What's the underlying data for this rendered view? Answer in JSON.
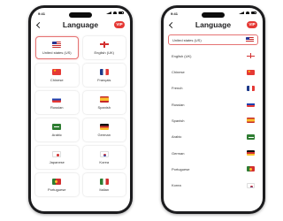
{
  "status_time": "9:41",
  "title": "Language",
  "badge": "VIP",
  "grid_items": [
    {
      "label": "United states (US)",
      "flag": "us",
      "selected": true
    },
    {
      "label": "English (UK)",
      "flag": "gb"
    },
    {
      "label": "Chinese",
      "flag": "cn"
    },
    {
      "label": "Français",
      "flag": "fr"
    },
    {
      "label": "Russian",
      "flag": "ru"
    },
    {
      "label": "Spanish",
      "flag": "es"
    },
    {
      "label": "Arabic",
      "flag": "ar"
    },
    {
      "label": "German",
      "flag": "de"
    },
    {
      "label": "Japanese",
      "flag": "jp"
    },
    {
      "label": "Korea",
      "flag": "kr"
    },
    {
      "label": "Portuguese",
      "flag": "pt"
    },
    {
      "label": "Italian",
      "flag": "it"
    }
  ],
  "list_items": [
    {
      "label": "United states (US)",
      "flag": "us",
      "selected": true
    },
    {
      "label": "English (UK)",
      "flag": "gb"
    },
    {
      "label": "Chinese",
      "flag": "cn"
    },
    {
      "label": "French",
      "flag": "fr"
    },
    {
      "label": "Russian",
      "flag": "ru"
    },
    {
      "label": "Spanish",
      "flag": "es"
    },
    {
      "label": "Arabic",
      "flag": "ar"
    },
    {
      "label": "German",
      "flag": "de"
    },
    {
      "label": "Portuguese",
      "flag": "pt"
    },
    {
      "label": "Korea",
      "flag": "kr"
    }
  ],
  "colors": {
    "accent": "#e53935",
    "selected_border": "#e57373",
    "phone_frame": "#1c1c1e"
  }
}
